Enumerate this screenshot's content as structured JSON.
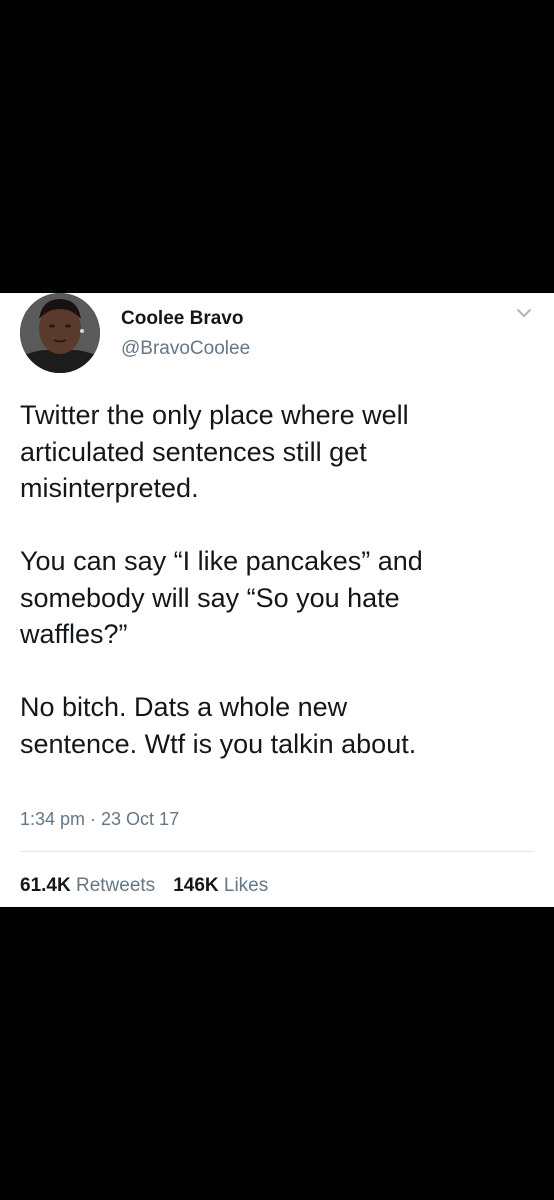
{
  "tweet": {
    "display_name": "Coolee Bravo",
    "handle": "@BravoCoolee",
    "paragraphs": [
      [
        "Twitter the only place where well",
        "articulated sentences still get",
        "misinterpreted."
      ],
      [
        "You can say “I like pancakes” and",
        "somebody will say “So you hate",
        "waffles?”"
      ],
      [
        "No bitch. Dats a whole new",
        "sentence. Wtf is you talkin about."
      ]
    ],
    "timestamp": "1:34 pm · 23 Oct 17",
    "retweets_count": "61.4K",
    "retweets_label": "Retweets",
    "likes_count": "146K",
    "likes_label": "Likes"
  },
  "colors": {
    "background": "#000000",
    "card": "#ffffff",
    "text_primary": "#14171a",
    "text_secondary": "#657786",
    "divider": "#e1e8ed"
  },
  "icons": {
    "menu": "chevron-down-icon",
    "avatar": "profile-photo"
  }
}
